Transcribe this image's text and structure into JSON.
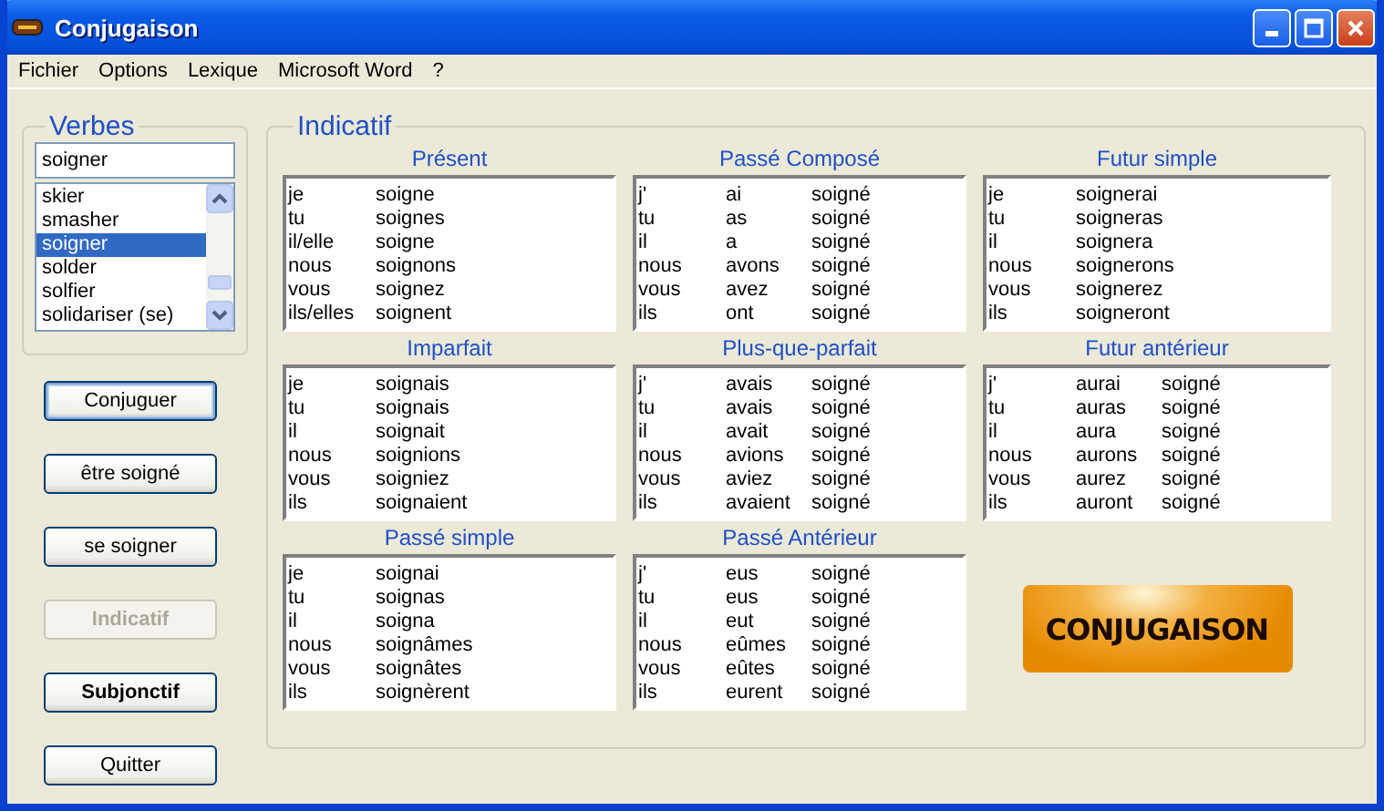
{
  "window": {
    "title": "Conjugaison"
  },
  "menu": [
    {
      "label": "Fichier"
    },
    {
      "label": "Options"
    },
    {
      "label": "Lexique"
    },
    {
      "label": "Microsoft Word"
    },
    {
      "label": "?"
    }
  ],
  "verbs": {
    "title": "Verbes",
    "search_value": "soigner",
    "items": [
      {
        "label": "skier",
        "selected": false
      },
      {
        "label": "smasher",
        "selected": false
      },
      {
        "label": "soigner",
        "selected": true
      },
      {
        "label": "solder",
        "selected": false
      },
      {
        "label": "solfier",
        "selected": false
      },
      {
        "label": "solidariser (se)",
        "selected": false
      }
    ]
  },
  "buttons": [
    {
      "label": "Conjuguer",
      "default": true,
      "disabled": false,
      "bold": false
    },
    {
      "label": "être soigné",
      "default": false,
      "disabled": false,
      "bold": false
    },
    {
      "label": "se soigner",
      "default": false,
      "disabled": false,
      "bold": false
    },
    {
      "label": "Indicatif",
      "default": false,
      "disabled": true,
      "bold": true
    },
    {
      "label": "Subjonctif",
      "default": false,
      "disabled": false,
      "bold": true
    },
    {
      "label": "Quitter",
      "default": false,
      "disabled": false,
      "bold": false
    }
  ],
  "mood": {
    "title": "Indicatif",
    "tenses": [
      {
        "title": "Présent",
        "rows": [
          [
            "je",
            "soigne"
          ],
          [
            "tu",
            "soignes"
          ],
          [
            "il/elle",
            "soigne"
          ],
          [
            "nous",
            "soignons"
          ],
          [
            "vous",
            "soignez"
          ],
          [
            "ils/elles",
            "soignent"
          ]
        ]
      },
      {
        "title": "Passé Composé",
        "rows": [
          [
            "j'",
            "ai",
            "soigné"
          ],
          [
            "tu",
            "as",
            "soigné"
          ],
          [
            "il",
            "a",
            "soigné"
          ],
          [
            "nous",
            "avons",
            "soigné"
          ],
          [
            "vous",
            "avez",
            "soigné"
          ],
          [
            "ils",
            "ont",
            "soigné"
          ]
        ]
      },
      {
        "title": "Futur simple",
        "rows": [
          [
            "je",
            "soignerai"
          ],
          [
            "tu",
            "soigneras"
          ],
          [
            "il",
            "soignera"
          ],
          [
            "nous",
            "soignerons"
          ],
          [
            "vous",
            "soignerez"
          ],
          [
            "ils",
            "soigneront"
          ]
        ]
      },
      {
        "title": "Imparfait",
        "rows": [
          [
            "je",
            "soignais"
          ],
          [
            "tu",
            "soignais"
          ],
          [
            "il",
            "soignait"
          ],
          [
            "nous",
            "soignions"
          ],
          [
            "vous",
            "soigniez"
          ],
          [
            "ils",
            "soignaient"
          ]
        ]
      },
      {
        "title": "Plus-que-parfait",
        "rows": [
          [
            "j'",
            "avais",
            "soigné"
          ],
          [
            "tu",
            "avais",
            "soigné"
          ],
          [
            "il",
            "avait",
            "soigné"
          ],
          [
            "nous",
            "avions",
            "soigné"
          ],
          [
            "vous",
            "aviez",
            "soigné"
          ],
          [
            "ils",
            "avaient",
            "soigné"
          ]
        ]
      },
      {
        "title": "Futur antérieur",
        "rows": [
          [
            "j'",
            "aurai",
            "soigné"
          ],
          [
            "tu",
            "auras",
            "soigné"
          ],
          [
            "il",
            "aura",
            "soigné"
          ],
          [
            "nous",
            "aurons",
            "soigné"
          ],
          [
            "vous",
            "aurez",
            "soigné"
          ],
          [
            "ils",
            "auront",
            "soigné"
          ]
        ]
      },
      {
        "title": "Passé simple",
        "rows": [
          [
            "je",
            "soignai"
          ],
          [
            "tu",
            "soignas"
          ],
          [
            "il",
            "soigna"
          ],
          [
            "nous",
            "soignâmes"
          ],
          [
            "vous",
            "soignâtes"
          ],
          [
            "ils",
            "soignèrent"
          ]
        ]
      },
      {
        "title": "Passé Antérieur",
        "rows": [
          [
            "j'",
            "eus",
            "soigné"
          ],
          [
            "tu",
            "eus",
            "soigné"
          ],
          [
            "il",
            "eut",
            "soigné"
          ],
          [
            "nous",
            "eûmes",
            "soigné"
          ],
          [
            "vous",
            "eûtes",
            "soigné"
          ],
          [
            "ils",
            "eurent",
            "soigné"
          ]
        ]
      }
    ]
  },
  "logo": {
    "text": "CONJUGAISON"
  }
}
